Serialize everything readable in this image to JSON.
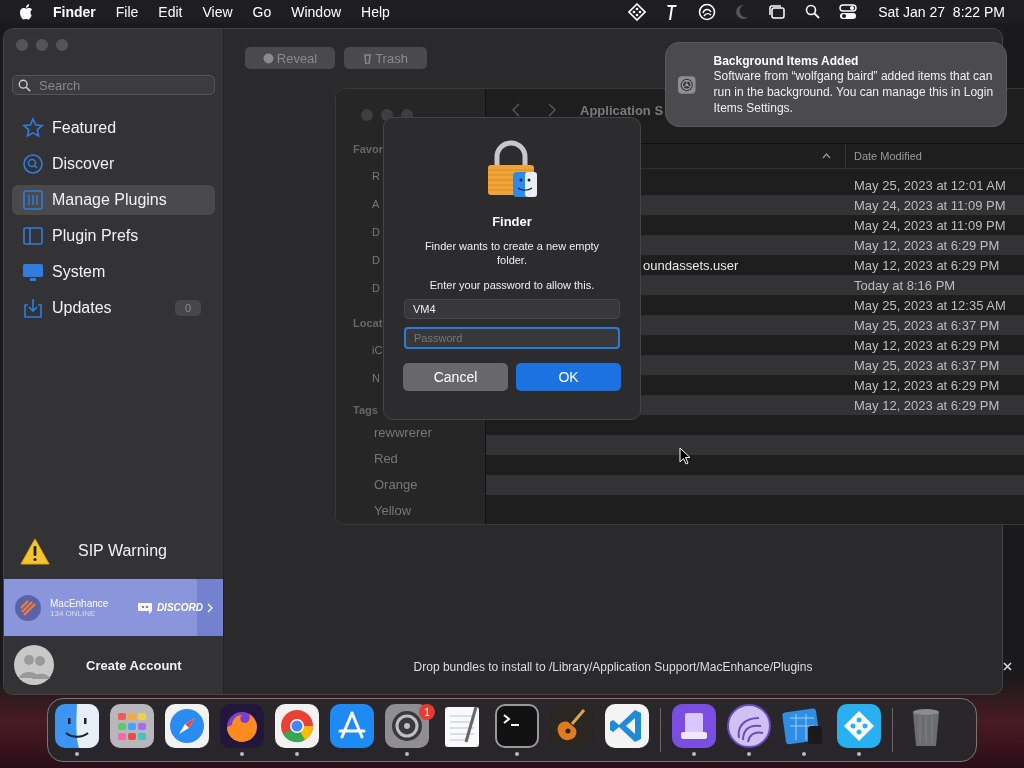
{
  "menubar": {
    "app": "Finder",
    "menus": [
      "File",
      "Edit",
      "View",
      "Go",
      "Window",
      "Help"
    ],
    "clock": "Sat Jan 27  8:22 PM"
  },
  "app_window": {
    "search": {
      "placeholder": "Search"
    },
    "toolbar": [
      {
        "label": "Reveal",
        "kind": "reveal",
        "disabled": true
      },
      {
        "label": "Trash",
        "kind": "trash",
        "disabled": true
      }
    ],
    "sidebar": [
      {
        "label": "Featured",
        "kind": "star",
        "selected": false
      },
      {
        "label": "Discover",
        "kind": "discover",
        "selected": false
      },
      {
        "label": "Manage Plugins",
        "kind": "plugins",
        "selected": true
      },
      {
        "label": "Plugin Prefs",
        "kind": "prefs",
        "selected": false
      },
      {
        "label": "System",
        "kind": "system",
        "selected": false
      },
      {
        "label": "Updates",
        "kind": "updates",
        "selected": false,
        "badge": "0"
      }
    ],
    "sip_warning": "SIP Warning",
    "community": {
      "name": "MacEnhance",
      "online": "134 ONLINE",
      "service": "DISCORD"
    },
    "account": "Create Account",
    "status": "Drop bundles to install to /Library/Application Support/MacEnhance/Plugins"
  },
  "finder_window": {
    "path": "Application S",
    "sidebar_sections": [
      {
        "heading": "Favor",
        "items": [
          "R",
          "A",
          "D",
          "D",
          "D"
        ]
      },
      {
        "heading": "Locat",
        "items": [
          "iC",
          "N"
        ]
      },
      {
        "heading": "Tags",
        "items": [
          "rewwrerer",
          "Red",
          "Orange",
          "Yellow"
        ]
      }
    ],
    "date_column": "Date Modified",
    "rows": [
      {
        "date": "May 25, 2023 at 12:01 AM"
      },
      {
        "date": "May 24, 2023 at 11:09 PM"
      },
      {
        "date": "May 24, 2023 at 11:09 PM"
      },
      {
        "date": "May 12, 2023 at 6:29 PM"
      },
      {
        "name": "oundassets.user",
        "date": "May 12, 2023 at 6:29 PM"
      },
      {
        "date": "Today at 8:16 PM"
      },
      {
        "date": "May 25, 2023 at 12:35 AM"
      },
      {
        "date": "May 25, 2023 at 6:37 PM"
      },
      {
        "date": "May 12, 2023 at 6:29 PM"
      },
      {
        "date": "May 25, 2023 at 6:37 PM"
      },
      {
        "date": "May 12, 2023 at 6:29 PM"
      },
      {
        "date": "May 12, 2023 at 6:29 PM"
      }
    ]
  },
  "dialog": {
    "app": "Finder",
    "message": "Finder wants to create a new empty folder.",
    "prompt": "Enter your password to allow this.",
    "username": "VM4",
    "password": {
      "placeholder": "Password"
    },
    "buttons": [
      {
        "label": "Cancel",
        "kind": "secondary"
      },
      {
        "label": "OK",
        "kind": "default"
      }
    ]
  },
  "notification": {
    "title": "Background Items Added",
    "body": "Software from “wolfgang baird” added items that can run in the background. You can manage this in Login Items Settings."
  },
  "dock": {
    "apps": [
      {
        "kind": "finder",
        "running": true
      },
      {
        "kind": "launchpad",
        "running": false
      },
      {
        "kind": "safari",
        "running": false
      },
      {
        "kind": "firefox",
        "running": true
      },
      {
        "kind": "chrome",
        "running": true
      },
      {
        "kind": "appstore",
        "running": false
      },
      {
        "kind": "settings",
        "running": true,
        "badge": "1"
      },
      {
        "kind": "textedit",
        "running": false
      },
      {
        "kind": "terminal",
        "running": true
      },
      {
        "kind": "guitar",
        "running": false
      },
      {
        "kind": "vscode",
        "running": false
      },
      {
        "kind": "divider"
      },
      {
        "kind": "drive",
        "running": true
      },
      {
        "kind": "swirl",
        "running": true
      },
      {
        "kind": "blueprint",
        "running": true
      },
      {
        "kind": "diamond",
        "running": true
      },
      {
        "kind": "divider"
      },
      {
        "kind": "trash",
        "running": false
      }
    ]
  }
}
